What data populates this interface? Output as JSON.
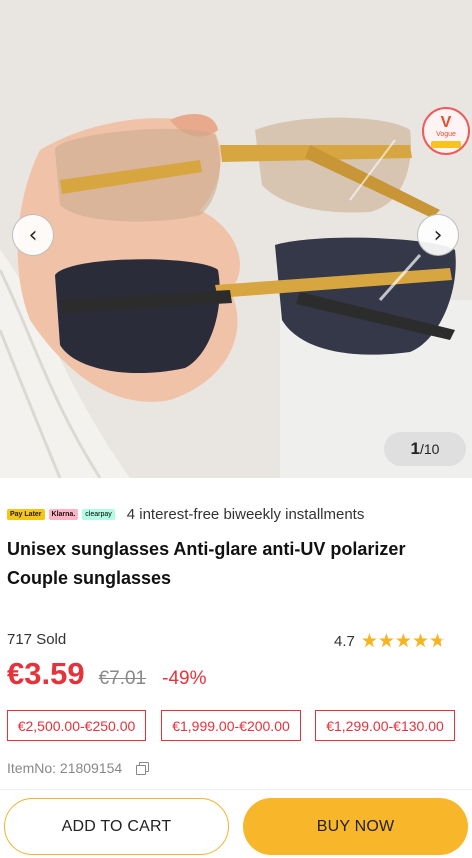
{
  "gallery": {
    "current": "1",
    "total": "/10",
    "promo_badge": {
      "text": "Vogue"
    }
  },
  "payments": {
    "logos": [
      "Pay Later",
      "Klarna.",
      "clearpay"
    ],
    "text": "4 interest-free biweekly installments"
  },
  "product": {
    "title": "Unisex sunglasses Anti-glare anti-UV polarizer Couple sunglasses",
    "sold": "717 Sold",
    "rating": "4.7",
    "rating_fraction": 0.94,
    "price": "€3.59",
    "old_price": "€7.01",
    "discount": "-49%",
    "coupons": [
      "€2,500.00-€250.00",
      "€1,999.00-€200.00",
      "€1,299.00-€130.00"
    ],
    "item_no": "ItemNo: 21809154"
  },
  "actions": {
    "add_to_cart": "ADD TO CART",
    "buy_now": "BUY NOW"
  },
  "colors": {
    "price_red": "#e5323b",
    "star": "#f6b41e",
    "buy_button": "#f8b62a"
  }
}
